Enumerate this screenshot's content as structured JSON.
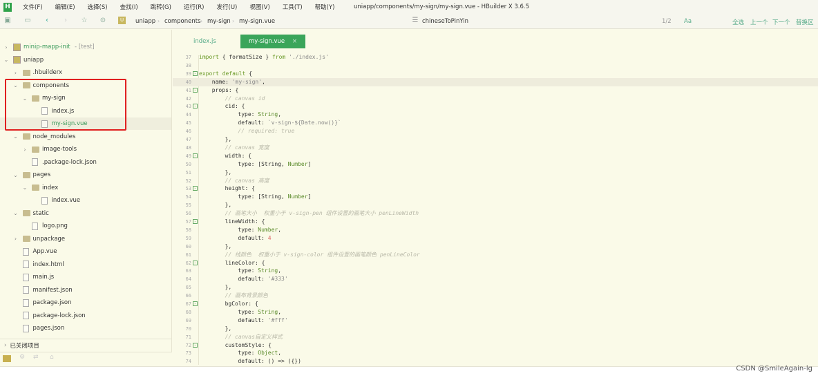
{
  "window": {
    "title": "uniapp/components/my-sign/my-sign.vue - HBuilder X 3.6.5",
    "logo": "H"
  },
  "menu": [
    "文件(F)",
    "编辑(E)",
    "选择(S)",
    "查找(I)",
    "跳转(G)",
    "运行(R)",
    "发行(U)",
    "视图(V)",
    "工具(T)",
    "帮助(Y)"
  ],
  "breadcrumb": [
    "uniapp",
    "components",
    "my-sign",
    "my-sign.vue"
  ],
  "outline": "chineseToPinYin",
  "find": {
    "count": "1/2",
    "case": "Aa",
    "all": "全选",
    "prev": "上一个",
    "next": "下一个",
    "replace": "替换区"
  },
  "tree": [
    {
      "label": "minip-mapp-init",
      "suffix": "- [test]",
      "level": 0,
      "type": "project",
      "arrow": "›"
    },
    {
      "label": "uniapp",
      "level": 0,
      "type": "project",
      "arrow": "⌄"
    },
    {
      "label": ".hbuilderx",
      "level": 1,
      "type": "folder",
      "arrow": "›"
    },
    {
      "label": "components",
      "level": 1,
      "type": "folder",
      "arrow": "⌄"
    },
    {
      "label": "my-sign",
      "level": 2,
      "type": "folder",
      "arrow": "⌄"
    },
    {
      "label": "index.js",
      "level": 3,
      "type": "file"
    },
    {
      "label": "my-sign.vue",
      "level": 3,
      "type": "file",
      "selected": true
    },
    {
      "label": "node_modules",
      "level": 1,
      "type": "folder",
      "arrow": "⌄"
    },
    {
      "label": "image-tools",
      "level": 2,
      "type": "folder",
      "arrow": "›"
    },
    {
      "label": ".package-lock.json",
      "level": 2,
      "type": "file"
    },
    {
      "label": "pages",
      "level": 1,
      "type": "folder",
      "arrow": "⌄"
    },
    {
      "label": "index",
      "level": 2,
      "type": "folder",
      "arrow": "⌄"
    },
    {
      "label": "index.vue",
      "level": 3,
      "type": "file"
    },
    {
      "label": "static",
      "level": 1,
      "type": "folder",
      "arrow": "⌄"
    },
    {
      "label": "logo.png",
      "level": 2,
      "type": "file"
    },
    {
      "label": "unpackage",
      "level": 1,
      "type": "folder",
      "arrow": "›"
    },
    {
      "label": "App.vue",
      "level": 1,
      "type": "file"
    },
    {
      "label": "index.html",
      "level": 1,
      "type": "file"
    },
    {
      "label": "main.js",
      "level": 1,
      "type": "file"
    },
    {
      "label": "manifest.json",
      "level": 1,
      "type": "file"
    },
    {
      "label": "package.json",
      "level": 1,
      "type": "file"
    },
    {
      "label": "package-lock.json",
      "level": 1,
      "type": "file"
    },
    {
      "label": "pages.json",
      "level": 1,
      "type": "file"
    }
  ],
  "closed_projects": "已关闭项目",
  "tabs": [
    {
      "label": "index.js"
    },
    {
      "label": "my-sign.vue",
      "active": true,
      "close": "×"
    }
  ],
  "accent": "#3aa55a",
  "code": [
    {
      "n": 37,
      "i": 0,
      "t": [
        [
          "kw",
          "import"
        ],
        [
          "plain",
          " { formatSize } "
        ],
        [
          "kw",
          "from"
        ],
        [
          "str",
          " './index.js'"
        ]
      ]
    },
    {
      "n": 38,
      "i": 0,
      "t": []
    },
    {
      "n": 39,
      "i": 0,
      "f": true,
      "t": [
        [
          "kw",
          "export default"
        ],
        [
          "plain",
          " {"
        ]
      ]
    },
    {
      "n": 40,
      "i": 1,
      "hl": true,
      "t": [
        [
          "plain",
          "name: "
        ],
        [
          "str",
          "'my-sign'"
        ],
        [
          "plain",
          ","
        ]
      ]
    },
    {
      "n": 41,
      "i": 1,
      "f": true,
      "t": [
        [
          "plain",
          "props: {"
        ]
      ]
    },
    {
      "n": 42,
      "i": 2,
      "t": [
        [
          "cmt",
          "// canvas id"
        ]
      ]
    },
    {
      "n": 43,
      "i": 2,
      "f": true,
      "t": [
        [
          "plain",
          "cid: {"
        ]
      ]
    },
    {
      "n": 44,
      "i": 3,
      "t": [
        [
          "plain",
          "type: "
        ],
        [
          "typ",
          "String"
        ],
        [
          "plain",
          ","
        ]
      ]
    },
    {
      "n": 45,
      "i": 3,
      "t": [
        [
          "plain",
          "default: "
        ],
        [
          "str",
          "`v-sign-${Date.now()}`"
        ]
      ]
    },
    {
      "n": 46,
      "i": 3,
      "t": [
        [
          "cmt",
          "// required: true"
        ]
      ]
    },
    {
      "n": 47,
      "i": 2,
      "t": [
        [
          "plain",
          "},"
        ]
      ]
    },
    {
      "n": 48,
      "i": 2,
      "t": [
        [
          "cmt",
          "// canvas 宽度"
        ]
      ]
    },
    {
      "n": 49,
      "i": 2,
      "f": true,
      "t": [
        [
          "plain",
          "width: {"
        ]
      ]
    },
    {
      "n": 50,
      "i": 3,
      "t": [
        [
          "plain",
          "type: [String, "
        ],
        [
          "typ",
          "Number"
        ],
        [
          "plain",
          "]"
        ]
      ]
    },
    {
      "n": 51,
      "i": 2,
      "t": [
        [
          "plain",
          "},"
        ]
      ]
    },
    {
      "n": 52,
      "i": 2,
      "t": [
        [
          "cmt",
          "// canvas 高度"
        ]
      ]
    },
    {
      "n": 53,
      "i": 2,
      "f": true,
      "t": [
        [
          "plain",
          "height: {"
        ]
      ]
    },
    {
      "n": 54,
      "i": 3,
      "t": [
        [
          "plain",
          "type: [String, "
        ],
        [
          "typ",
          "Number"
        ],
        [
          "plain",
          "]"
        ]
      ]
    },
    {
      "n": 55,
      "i": 2,
      "t": [
        [
          "plain",
          "},"
        ]
      ]
    },
    {
      "n": 56,
      "i": 2,
      "t": [
        [
          "cmt",
          "// 画笔大小  权重小于 v-sign-pen 组件设置的画笔大小 penLineWidth"
        ]
      ]
    },
    {
      "n": 57,
      "i": 2,
      "f": true,
      "t": [
        [
          "plain",
          "lineWidth: {"
        ]
      ]
    },
    {
      "n": 58,
      "i": 3,
      "t": [
        [
          "plain",
          "type: "
        ],
        [
          "typ",
          "Number"
        ],
        [
          "plain",
          ","
        ]
      ]
    },
    {
      "n": 59,
      "i": 3,
      "t": [
        [
          "plain",
          "default: "
        ],
        [
          "num",
          "4"
        ]
      ]
    },
    {
      "n": 60,
      "i": 2,
      "t": [
        [
          "plain",
          "},"
        ]
      ]
    },
    {
      "n": 61,
      "i": 2,
      "t": [
        [
          "cmt",
          "// 线颜色  权重小于 v-sign-color 组件设置的画笔颜色 penLineColor"
        ]
      ]
    },
    {
      "n": 62,
      "i": 2,
      "f": true,
      "t": [
        [
          "plain",
          "lineColor: {"
        ]
      ]
    },
    {
      "n": 63,
      "i": 3,
      "t": [
        [
          "plain",
          "type: "
        ],
        [
          "typ",
          "String"
        ],
        [
          "plain",
          ","
        ]
      ]
    },
    {
      "n": 64,
      "i": 3,
      "t": [
        [
          "plain",
          "default: "
        ],
        [
          "str",
          "'#333'"
        ]
      ]
    },
    {
      "n": 65,
      "i": 2,
      "t": [
        [
          "plain",
          "},"
        ]
      ]
    },
    {
      "n": 66,
      "i": 2,
      "t": [
        [
          "cmt",
          "// 画布背景颜色"
        ]
      ]
    },
    {
      "n": 67,
      "i": 2,
      "f": true,
      "t": [
        [
          "plain",
          "bgColor: {"
        ]
      ]
    },
    {
      "n": 68,
      "i": 3,
      "t": [
        [
          "plain",
          "type: "
        ],
        [
          "typ",
          "String"
        ],
        [
          "plain",
          ","
        ]
      ]
    },
    {
      "n": 69,
      "i": 3,
      "t": [
        [
          "plain",
          "default: "
        ],
        [
          "str",
          "'#fff'"
        ]
      ]
    },
    {
      "n": 70,
      "i": 2,
      "t": [
        [
          "plain",
          "},"
        ]
      ]
    },
    {
      "n": 71,
      "i": 2,
      "t": [
        [
          "cmt",
          "// canvas自定义样式"
        ]
      ]
    },
    {
      "n": 72,
      "i": 2,
      "f": true,
      "t": [
        [
          "plain",
          "customStyle: {"
        ]
      ]
    },
    {
      "n": 73,
      "i": 3,
      "t": [
        [
          "plain",
          "type: "
        ],
        [
          "typ",
          "Object"
        ],
        [
          "plain",
          ","
        ]
      ]
    },
    {
      "n": 74,
      "i": 3,
      "t": [
        [
          "plain",
          "default: () => ({})"
        ]
      ]
    }
  ],
  "watermark": "CSDN @SmileAgain-lg"
}
